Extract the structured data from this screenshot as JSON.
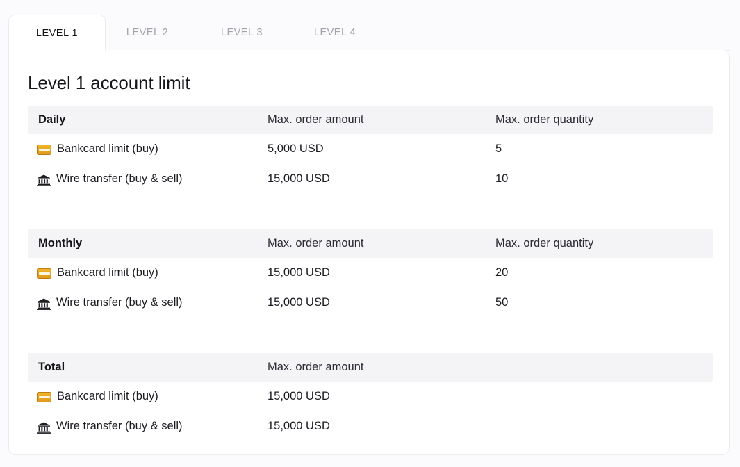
{
  "tabs": [
    {
      "label": "LEVEL 1",
      "active": true
    },
    {
      "label": "LEVEL 2",
      "active": false
    },
    {
      "label": "LEVEL 3",
      "active": false
    },
    {
      "label": "LEVEL 4",
      "active": false
    }
  ],
  "card": {
    "title": "Level 1 account limit"
  },
  "columns": {
    "amount": "Max. order amount",
    "quantity": "Max. order quantity"
  },
  "icons": {
    "bankcard": "credit-card-icon",
    "wire": "bank-building-icon"
  },
  "sections": [
    {
      "name": "Daily",
      "has_quantity": true,
      "rows": [
        {
          "icon": "credit-card-icon",
          "label": "Bankcard limit (buy)",
          "amount": "5,000 USD",
          "quantity": "5"
        },
        {
          "icon": "bank-building-icon",
          "label": "Wire transfer (buy & sell)",
          "amount": "15,000 USD",
          "quantity": "10"
        }
      ]
    },
    {
      "name": "Monthly",
      "has_quantity": true,
      "rows": [
        {
          "icon": "credit-card-icon",
          "label": "Bankcard limit (buy)",
          "amount": "15,000 USD",
          "quantity": "20"
        },
        {
          "icon": "bank-building-icon",
          "label": "Wire transfer (buy & sell)",
          "amount": "15,000 USD",
          "quantity": "50"
        }
      ]
    },
    {
      "name": "Total",
      "has_quantity": false,
      "rows": [
        {
          "icon": "credit-card-icon",
          "label": "Bankcard limit (buy)",
          "amount": "15,000 USD",
          "quantity": ""
        },
        {
          "icon": "bank-building-icon",
          "label": "Wire transfer (buy & sell)",
          "amount": "15,000 USD",
          "quantity": ""
        }
      ]
    }
  ],
  "colors": {
    "accent_card": "#e0a020",
    "header_band": "#f4f4f7",
    "text": "#15151a",
    "muted": "#a2a2a8"
  }
}
